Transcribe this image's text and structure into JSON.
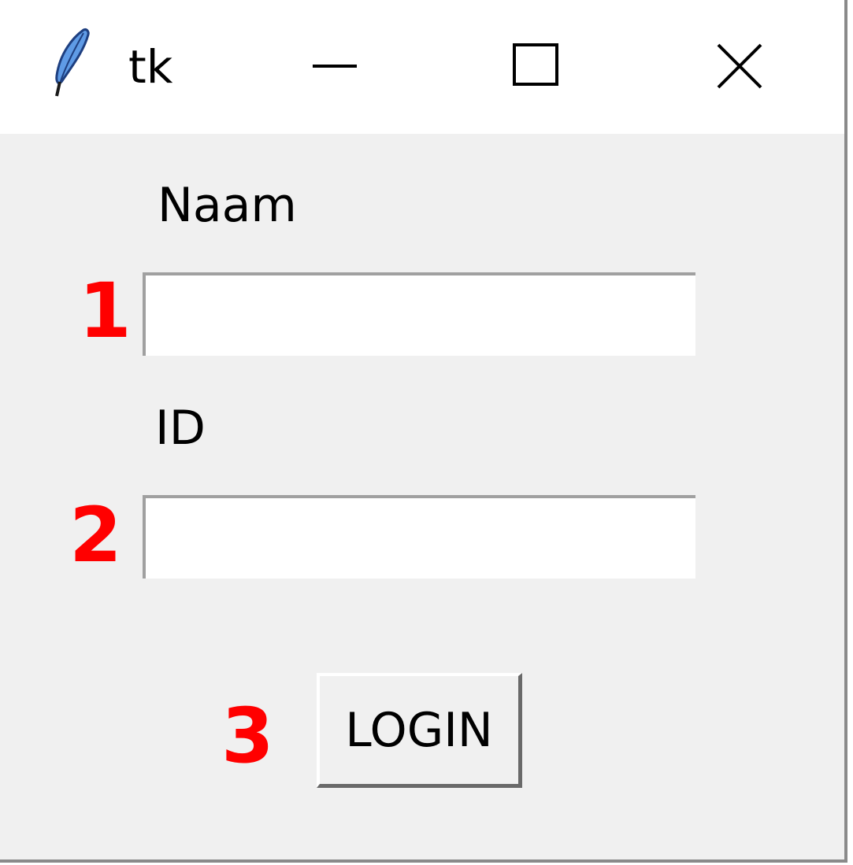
{
  "window": {
    "title": "tk",
    "app_icon": "feather-icon",
    "controls": {
      "minimize_icon": "minimize-icon",
      "maximize_icon": "maximize-icon",
      "close_icon": "close-icon"
    }
  },
  "form": {
    "name_label": "Naam",
    "name_value": "",
    "id_label": "ID",
    "id_value": "",
    "login_label": "LOGIN"
  },
  "annotations": {
    "marker_1": "1",
    "marker_2": "2",
    "marker_3": "3",
    "color": "#ff0000"
  },
  "colors": {
    "window_bg": "#f0f0f0",
    "titlebar_bg": "#ffffff",
    "entry_bg": "#ffffff"
  }
}
